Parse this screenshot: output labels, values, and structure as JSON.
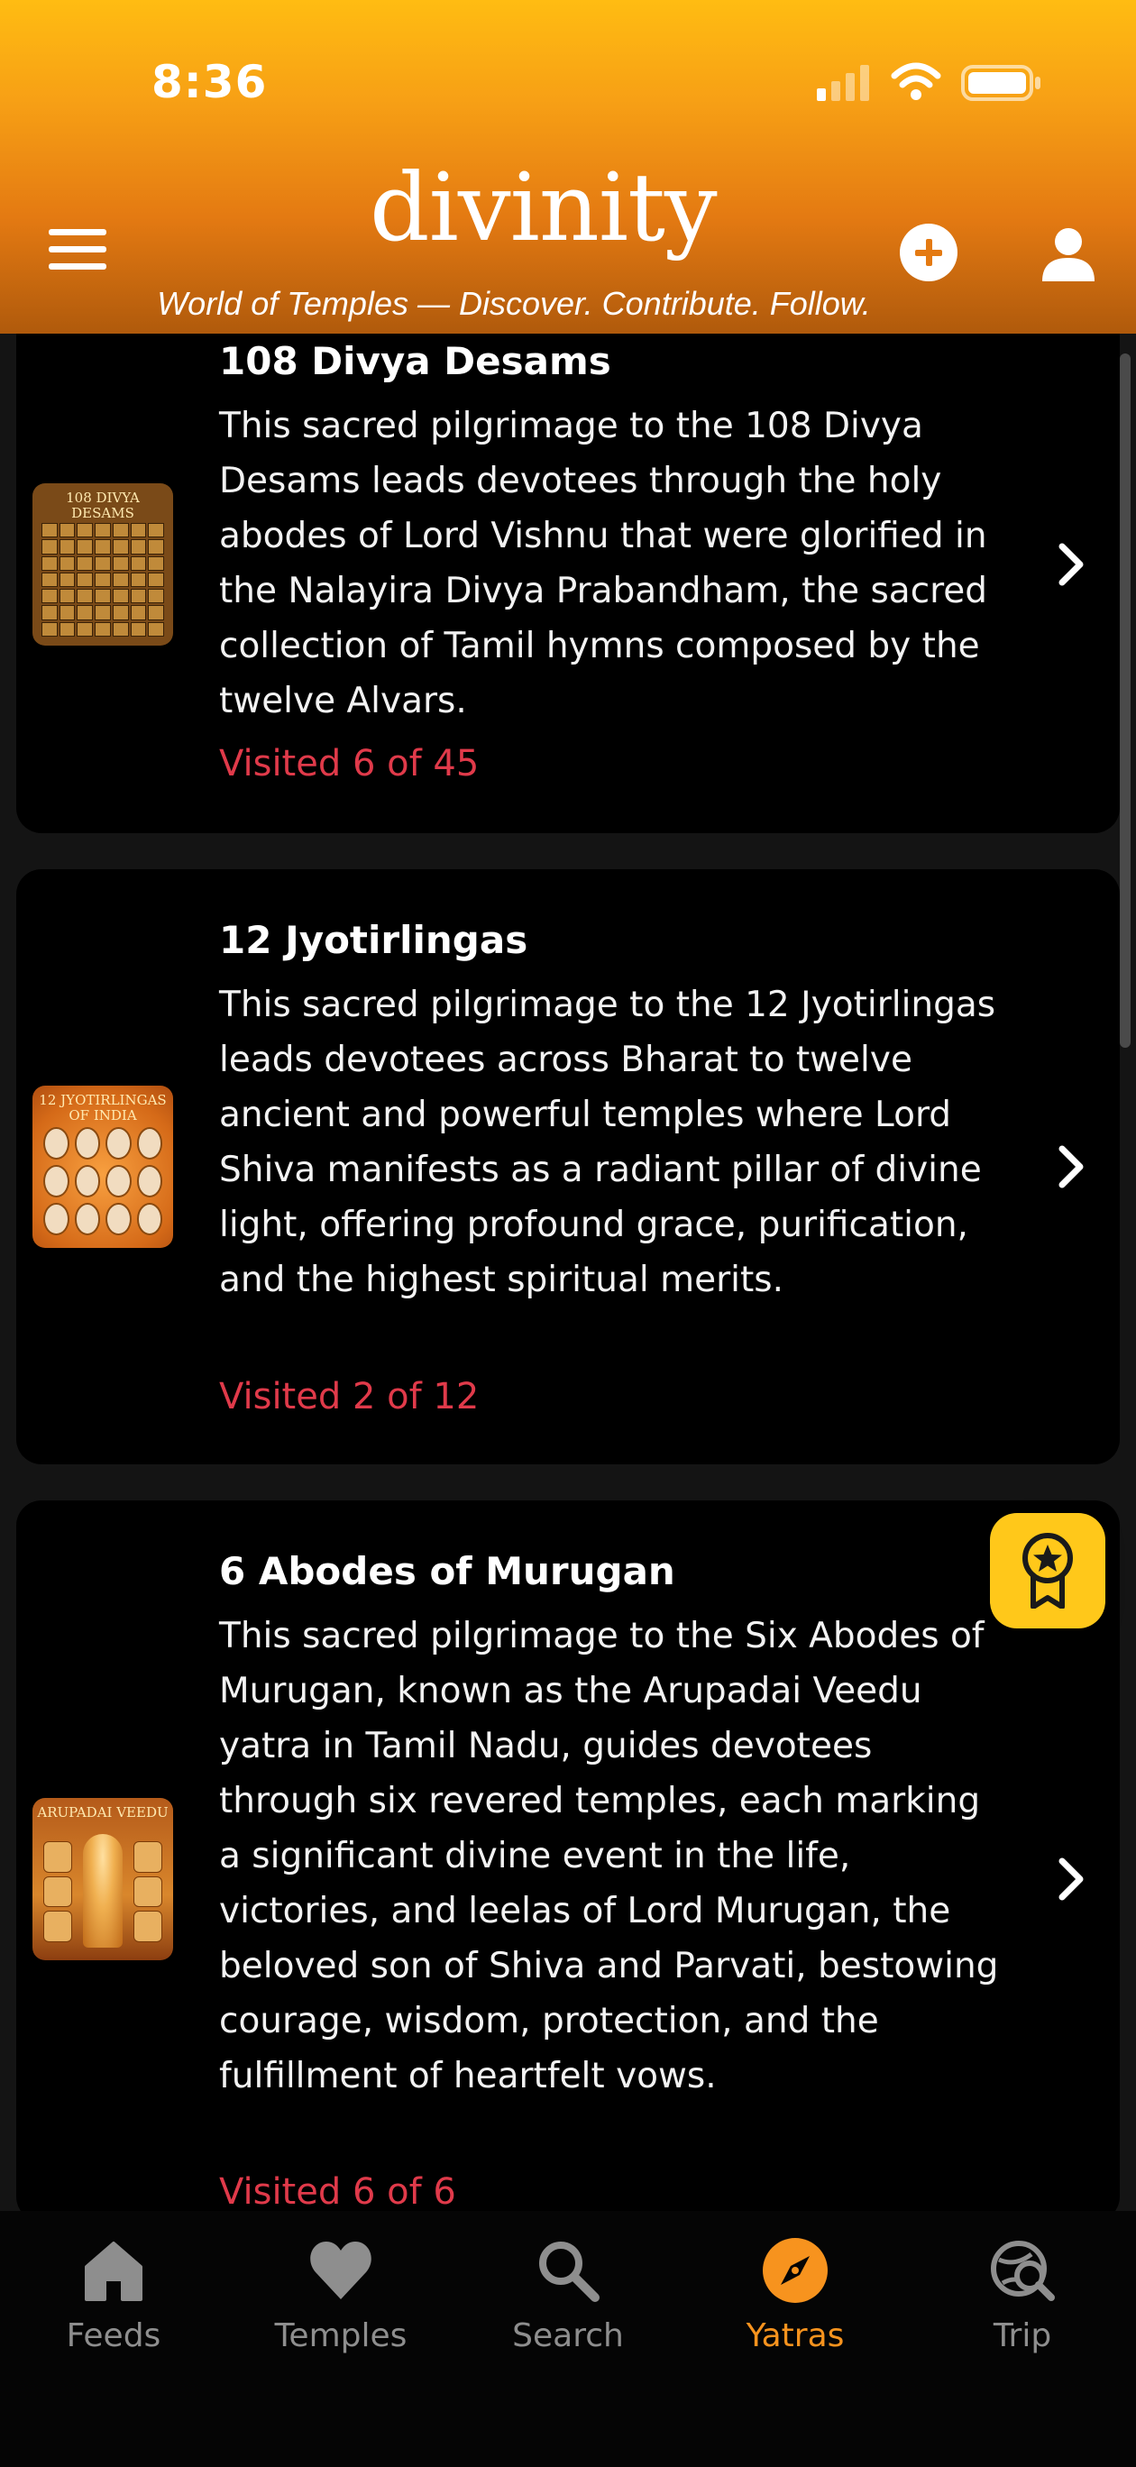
{
  "status_bar": {
    "time": "8:36"
  },
  "header": {
    "logo": "divinity",
    "tagline": "World of Temples — Discover. Contribute. Follow."
  },
  "yatras": [
    {
      "title": "108 Divya Desams",
      "thumbnail_text": "108 DIVYA DESAMS",
      "description": "This sacred pilgrimage to the 108 Divya Desams leads devotees through the holy abodes of Lord Vishnu that were glorified in the Nalayira Divya Prabandham, the sacred collection of Tamil hymns composed by the twelve Alvars.",
      "visited": "Visited 6 of 45"
    },
    {
      "title": "12 Jyotirlingas",
      "thumbnail_text": "12 JYOTIRLINGAS OF INDIA",
      "description": "This sacred pilgrimage to the 12 Jyotirlingas leads devotees across Bharat to twelve ancient and powerful temples where Lord Shiva manifests as a radiant pillar of divine light, offering profound grace, purification, and the highest spiritual merits.",
      "visited": "Visited 2 of 12"
    },
    {
      "title": "6 Abodes of Murugan",
      "thumbnail_text": "ARUPADAI VEEDU",
      "description": "This sacred pilgrimage to the Six Abodes of Murugan, known as the Arupadai Veedu yatra in Tamil Nadu, guides devotees through six revered temples, each marking a significant divine event in the life, victories, and leelas of Lord Murugan, the beloved son of Shiva and Parvati, bestowing courage, wisdom, protection, and the fulfillment of heartfelt vows.",
      "visited": "Visited 6 of 6"
    }
  ],
  "bottom_nav": {
    "items": [
      {
        "label": "Feeds",
        "icon": "home-icon"
      },
      {
        "label": "Temples",
        "icon": "heart-icon"
      },
      {
        "label": "Search",
        "icon": "search-icon"
      },
      {
        "label": "Yatras",
        "icon": "compass-icon",
        "active": true
      },
      {
        "label": "Trip",
        "icon": "globe-search-icon"
      }
    ]
  },
  "colors": {
    "header_top": "#ffbc12",
    "header_bottom": "#b05a0c",
    "visited_text": "#e03a4a",
    "active_tab": "#f7931e",
    "badge": "#ffc81a"
  }
}
